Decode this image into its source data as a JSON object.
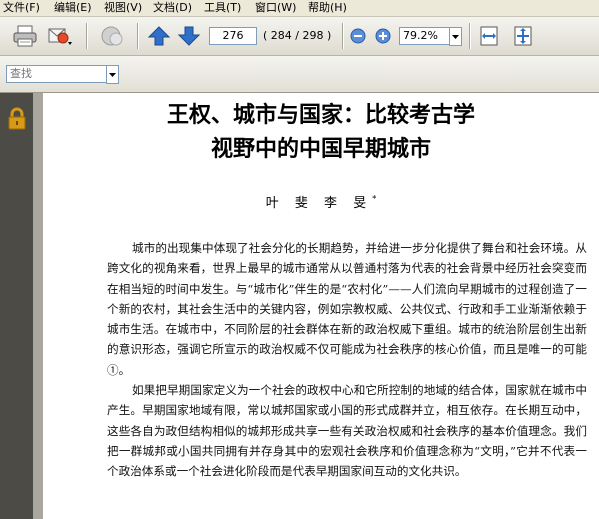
{
  "menu": [
    {
      "label": "文件(F)"
    },
    {
      "label": "编辑(E)"
    },
    {
      "label": "视图(V)"
    },
    {
      "label": "文档(D)"
    },
    {
      "label": "工具(T)"
    },
    {
      "label": "窗口(W)"
    },
    {
      "label": "帮助(H)"
    }
  ],
  "toolbar": {
    "current_page": "276",
    "page_count": "( 284 / 298 )",
    "zoom": "79.2%"
  },
  "find": {
    "placeholder": "查找"
  },
  "document": {
    "title_line1": "王权、城市与国家：比较考古学",
    "title_line2": "视野中的中国早期城市",
    "authors": "叶 斐 李 旻",
    "author_mark": "*",
    "paragraph1": "城市的出现集中体现了社会分化的长期趋势，并给进一步分化提供了舞台和社会环境。从跨文化的视角来看，世界上最早的城市通常从以普通村落为代表的社会背景中经历社会突变而在相当短的时间中发生。与“城市化”伴生的是“农村化”——人们流向早期城市的过程创造了一个新的农村，其社会生活中的关键内容，例如宗教权威、公共仪式、行政和手工业渐渐依赖于城市生活。在城市中，不同阶层的社会群体在新的政治权威下重组。城市的统治阶层创生出新的意识形态，强调它所宣示的政治权威不仅可能成为社会秩序的核心价值，而且是唯一的可能①。",
    "paragraph2": "如果把早期国家定义为一个社会的政权中心和它所控制的地域的结合体，国家就在城市中产生。早期国家地域有限，常以城邦国家或小国的形式成群并立，相互依存。在长期互动中，这些各自为政但结构相似的城邦形成共享一些有关政治权威和社会秩序的基本价值理念。我们把一群城邦或小国共同拥有并存身其中的宏观社会秩序和价值理念称为“文明，”它并不代表一个政治体系或一个社会进化阶段而是代表早期国家间互动的文化共识。"
  },
  "colors": {
    "arrow_blue": "#2f6fc7",
    "nav_panel": "#4c4b46",
    "lock_gold": "#d79a16"
  },
  "icons": [
    "print-icon",
    "email-icon",
    "collaborate-icon",
    "previous-page-icon",
    "next-page-icon",
    "zoom-out-icon",
    "zoom-in-icon",
    "fit-width-icon",
    "fit-page-icon",
    "lock-icon"
  ]
}
